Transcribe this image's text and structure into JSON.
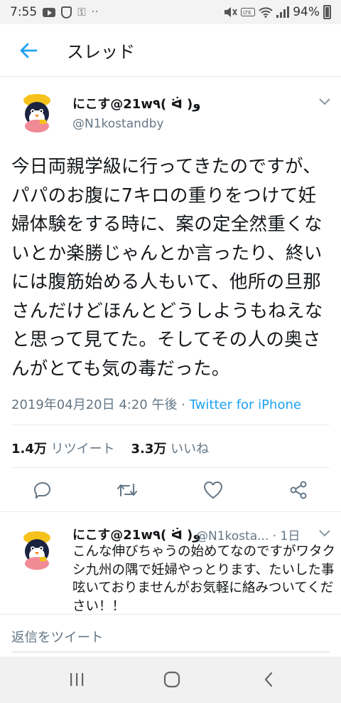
{
  "status_bar": {
    "time": "7:55",
    "dots": "··",
    "battery": "94%"
  },
  "header": {
    "title": "スレッド",
    "back_icon": "arrow-left-icon"
  },
  "tweet": {
    "author_name": "にこす@21w٩( ᐛ )و",
    "author_handle": "@N1kostandby",
    "text": "今日両親学級に行ってきたのですが、パパのお腹に7キロの重りをつけて妊婦体験をする時に、案の定全然重くないとか楽勝じゃんとか言ったり、終いには腹筋始める人もいて、他所の旦那さんだけどほんとどうしようもねえなと思って見てた。そしてその人の奥さんがとても気の毒だった。",
    "timestamp": "2019年04月20日 4:20 午後",
    "meta_separator": " · ",
    "source": "Twitter for iPhone",
    "retweets_count": "1.4万",
    "retweets_label": "リツイート",
    "likes_count": "3.3万",
    "likes_label": "いいね"
  },
  "reply": {
    "author_name": "にこす@21w٩( ᐛ )و",
    "handle_time": "@N1kosta... · 1日",
    "text": "こんな伸びちゃうの始めてなのですがワタクシ九州の隅で妊婦やっとります、たいした事呟いておりませんがお気軽に絡みついてください！！"
  },
  "compose": {
    "placeholder": "返信をツイート"
  },
  "colors": {
    "accent": "#1da1f2",
    "secondary_text": "#657786",
    "divider": "#e6ecf0"
  }
}
